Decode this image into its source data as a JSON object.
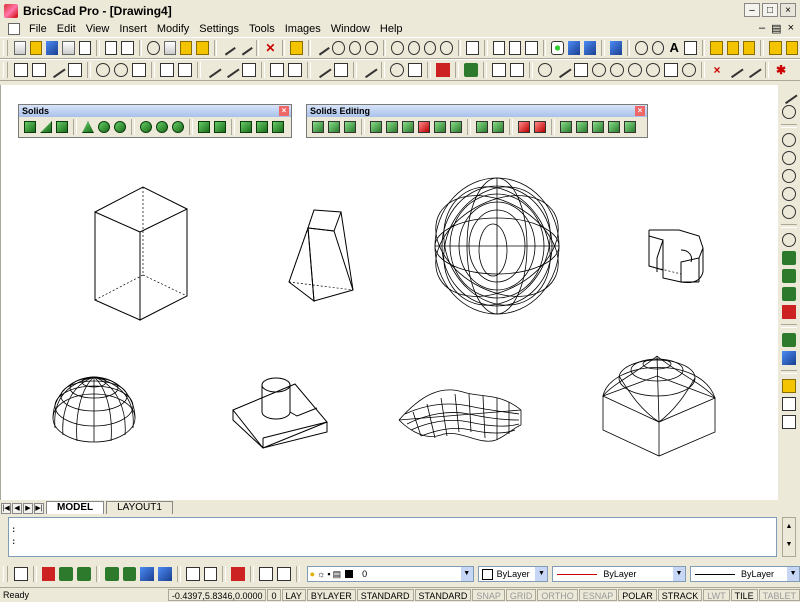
{
  "window": {
    "title": "BricsCad Pro - [Drawing4]"
  },
  "menu": {
    "items": [
      "File",
      "Edit",
      "View",
      "Insert",
      "Modify",
      "Settings",
      "Tools",
      "Images",
      "Window",
      "Help"
    ]
  },
  "solids_toolbar": {
    "title": "Solids",
    "icons": [
      "box-icon",
      "wedge-icon",
      "cube-icon",
      "cone-icon",
      "cylinder-icon",
      "sphere-icon",
      "dome-icon",
      "dish-icon",
      "torus-icon",
      "extrude-icon",
      "revolve-icon",
      "slice-icon",
      "section-icon",
      "interfere-icon"
    ]
  },
  "solids_editing_toolbar": {
    "title": "Solids Editing",
    "icons": [
      "union-icon",
      "subtract-icon",
      "intersect-icon",
      "extrude-faces-icon",
      "move-faces-icon",
      "rotate-faces-icon",
      "offset-faces-icon",
      "delete-faces-icon",
      "taper-faces-icon",
      "copy-faces-icon",
      "color-faces-icon",
      "copy-edges-icon",
      "color-edges-icon",
      "imprint-icon",
      "separate-icon",
      "shell-icon",
      "check-icon",
      "clean-icon"
    ]
  },
  "tabs": {
    "model": "MODEL",
    "layout1": "LAYOUT1"
  },
  "command": {
    "line1": ":",
    "line2": ":"
  },
  "properties": {
    "layer": "0",
    "color": "ByLayer",
    "linetype": "ByLayer",
    "lineweight": "ByLayer"
  },
  "status": {
    "ready": "Ready",
    "coords": "-0.4397,5.8346,0.0000",
    "items": [
      {
        "label": "0",
        "on": true
      },
      {
        "label": "LAY",
        "on": true
      },
      {
        "label": "BYLAYER",
        "on": true
      },
      {
        "label": "STANDARD",
        "on": true
      },
      {
        "label": "STANDARD",
        "on": true
      },
      {
        "label": "SNAP",
        "on": false
      },
      {
        "label": "GRID",
        "on": false
      },
      {
        "label": "ORTHO",
        "on": false
      },
      {
        "label": "ESNAP",
        "on": false
      },
      {
        "label": "POLAR",
        "on": true
      },
      {
        "label": "STRACK",
        "on": true
      },
      {
        "label": "LWT",
        "on": false
      },
      {
        "label": "TILE",
        "on": true
      },
      {
        "label": "TABLET",
        "on": false
      }
    ]
  }
}
